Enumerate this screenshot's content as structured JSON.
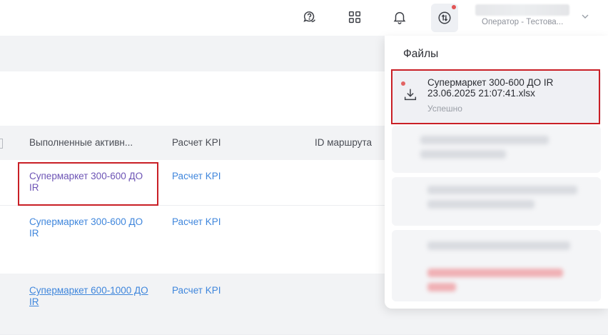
{
  "header": {
    "icons": [
      "help-chat-icon",
      "apps-grid-icon",
      "bell-icon",
      "exchange-arrows-icon"
    ],
    "user_role": "Оператор - Тестова...",
    "notification_color": "#e25555"
  },
  "table": {
    "columns": [
      "Выполненные активн...",
      "Расчет KPI",
      "ID маршрута"
    ],
    "rows": [
      {
        "activity": "Супермаркет 300-600 ДО IR",
        "kpi": "Расчет KPI"
      },
      {
        "activity": "Супермаркет 300-600 ДО IR",
        "kpi": "Расчет KPI"
      },
      {
        "activity": "Супермаркет 600-1000 ДО IR",
        "kpi": "Расчет KPI"
      }
    ],
    "link_color": "#3f86dc"
  },
  "files_panel": {
    "title": "Файлы",
    "items": [
      {
        "name": "Супермаркет 300-600 ДО IR 23.06.2025 21:07:41.xlsx",
        "status": "Успешно"
      }
    ]
  },
  "highlight_color": "#c91f26"
}
